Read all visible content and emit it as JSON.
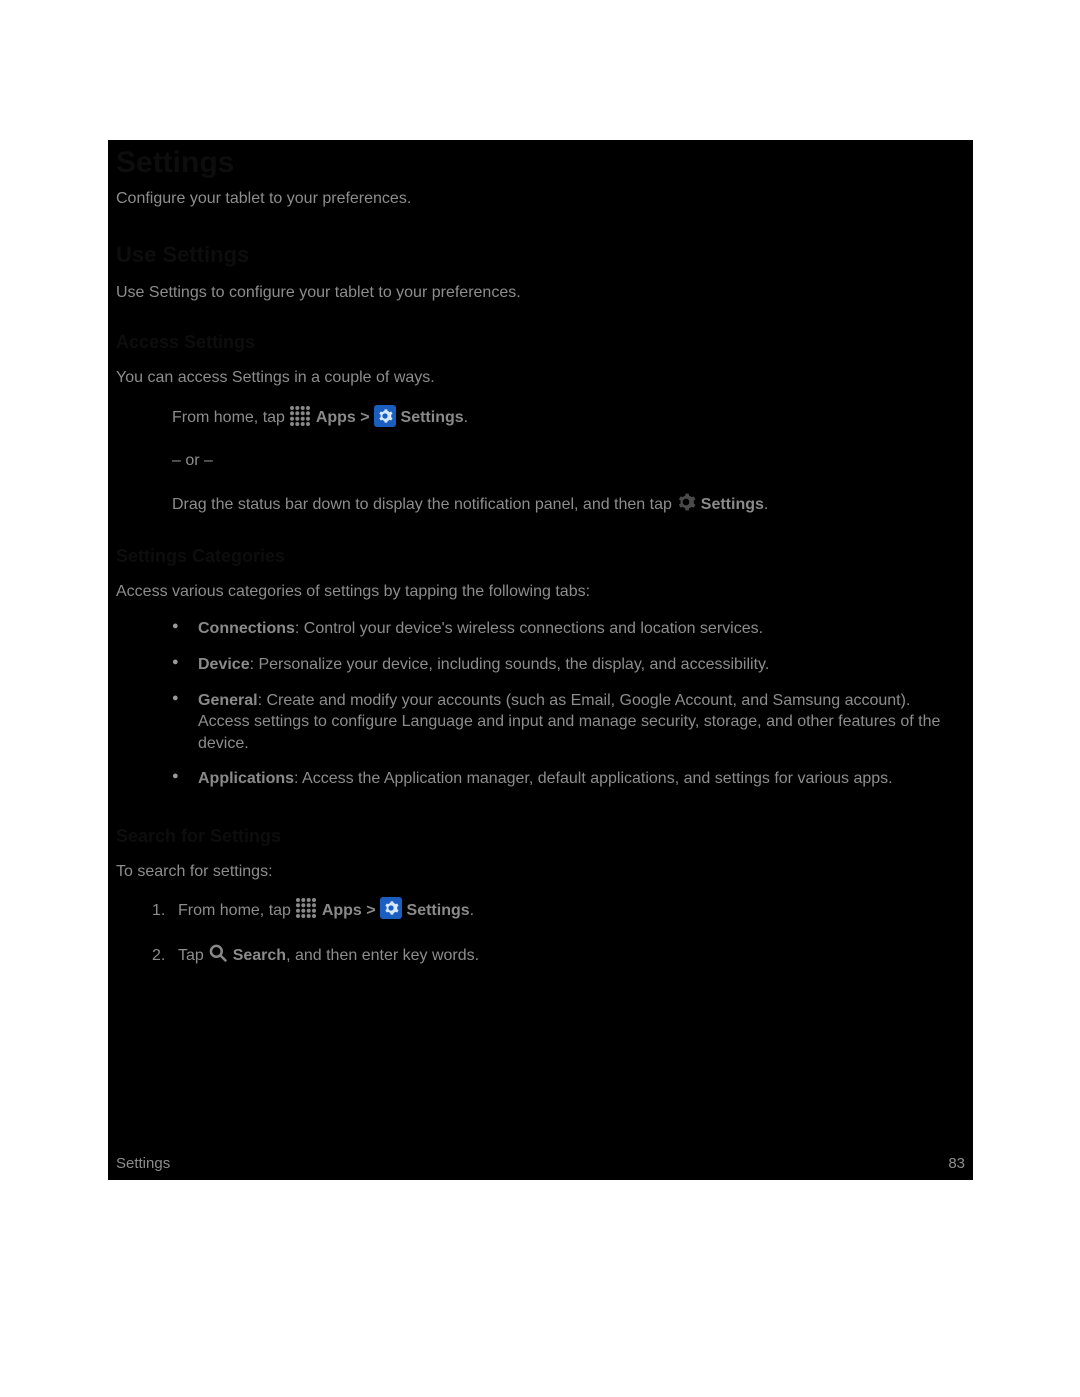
{
  "title": "Settings",
  "intro": "Configure your tablet to your preferences.",
  "sections": {
    "useSettings": {
      "heading": "Use Settings",
      "text": "Use Settings to configure your tablet to your preferences."
    },
    "accessSettings": {
      "heading": "Access Settings",
      "text": "You can access Settings in a couple of ways.",
      "step1_prefix": "From home, tap ",
      "apps_label": "Apps",
      "gt": " > ",
      "settings_label": "Settings",
      "period": ".",
      "or": "– or –",
      "step2_prefix": "Drag the status bar down to display the notification panel, and then tap ",
      "step2_settings": "Settings"
    },
    "categories": {
      "heading": "Settings Categories",
      "text": "Access various categories of settings by tapping the following tabs:",
      "items": [
        {
          "term": "Connections",
          "desc": ": Control your device's wireless connections and location services."
        },
        {
          "term": "Device",
          "desc": ": Personalize your device, including sounds, the display, and accessibility."
        },
        {
          "term": "General",
          "desc": ": Create and modify your accounts (such as Email, Google Account, and Samsung account). Access settings to configure Language and input and manage security, storage, and other features of the device."
        },
        {
          "term": "Applications",
          "desc": ": Access the Application manager, default applications, and settings for various apps."
        }
      ]
    },
    "search": {
      "heading": "Search for Settings",
      "text": "To search for settings:",
      "step1_prefix": "From home, tap ",
      "step2_prefix": "Tap ",
      "search_label": "Search",
      "step2_suffix": ", and then enter key words."
    }
  },
  "footer": {
    "left": "Settings",
    "right": "83"
  }
}
